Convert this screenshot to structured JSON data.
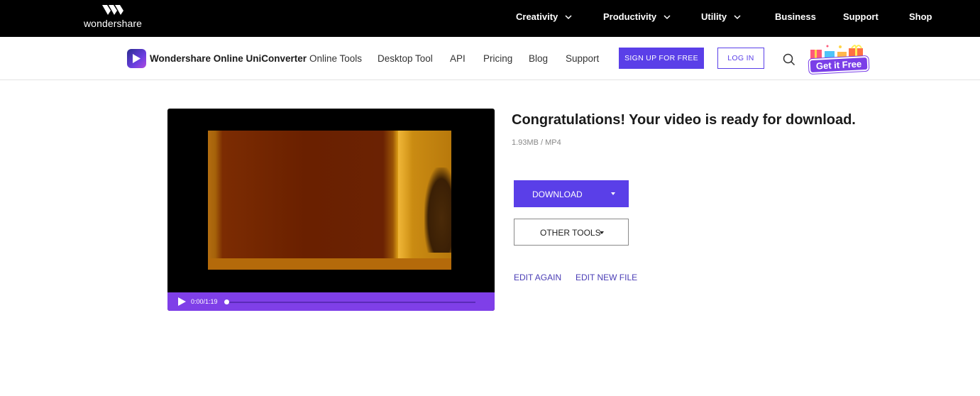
{
  "topbar": {
    "brand": "wondershare",
    "nav": [
      {
        "label": "Creativity",
        "dropdown": true
      },
      {
        "label": "Productivity",
        "dropdown": true
      },
      {
        "label": "Utility",
        "dropdown": true
      },
      {
        "label": "Business",
        "dropdown": false
      },
      {
        "label": "Support",
        "dropdown": false
      },
      {
        "label": "Shop",
        "dropdown": false
      }
    ]
  },
  "subnav": {
    "product_name": "Wondershare Online UniConverter",
    "links": [
      "Online Tools",
      "Desktop Tool",
      "API",
      "Pricing",
      "Blog",
      "Support"
    ],
    "signup_label": "SIGN UP FOR FREE",
    "login_label": "LOG IN",
    "promo_label": "Get it Free"
  },
  "player": {
    "time": "0:00/1:19",
    "progress": 0.0
  },
  "result": {
    "headline": "Congratulations! Your video is ready for download.",
    "file_info": "1.93MB / MP4",
    "download_label": "DOWNLOAD",
    "other_tools_label": "OTHER TOOLS",
    "edit_again_label": "EDIT AGAIN",
    "edit_new_label": "EDIT NEW FILE"
  },
  "colors": {
    "accent": "#5a3fe8",
    "player_bar": "#7f3fe8",
    "link": "#4a3db5"
  },
  "icons": [
    "wondershare-logo-icon",
    "chevron-down-icon",
    "uniconverter-logo-icon",
    "search-icon",
    "gift-icon",
    "play-icon",
    "caret-down-icon"
  ]
}
